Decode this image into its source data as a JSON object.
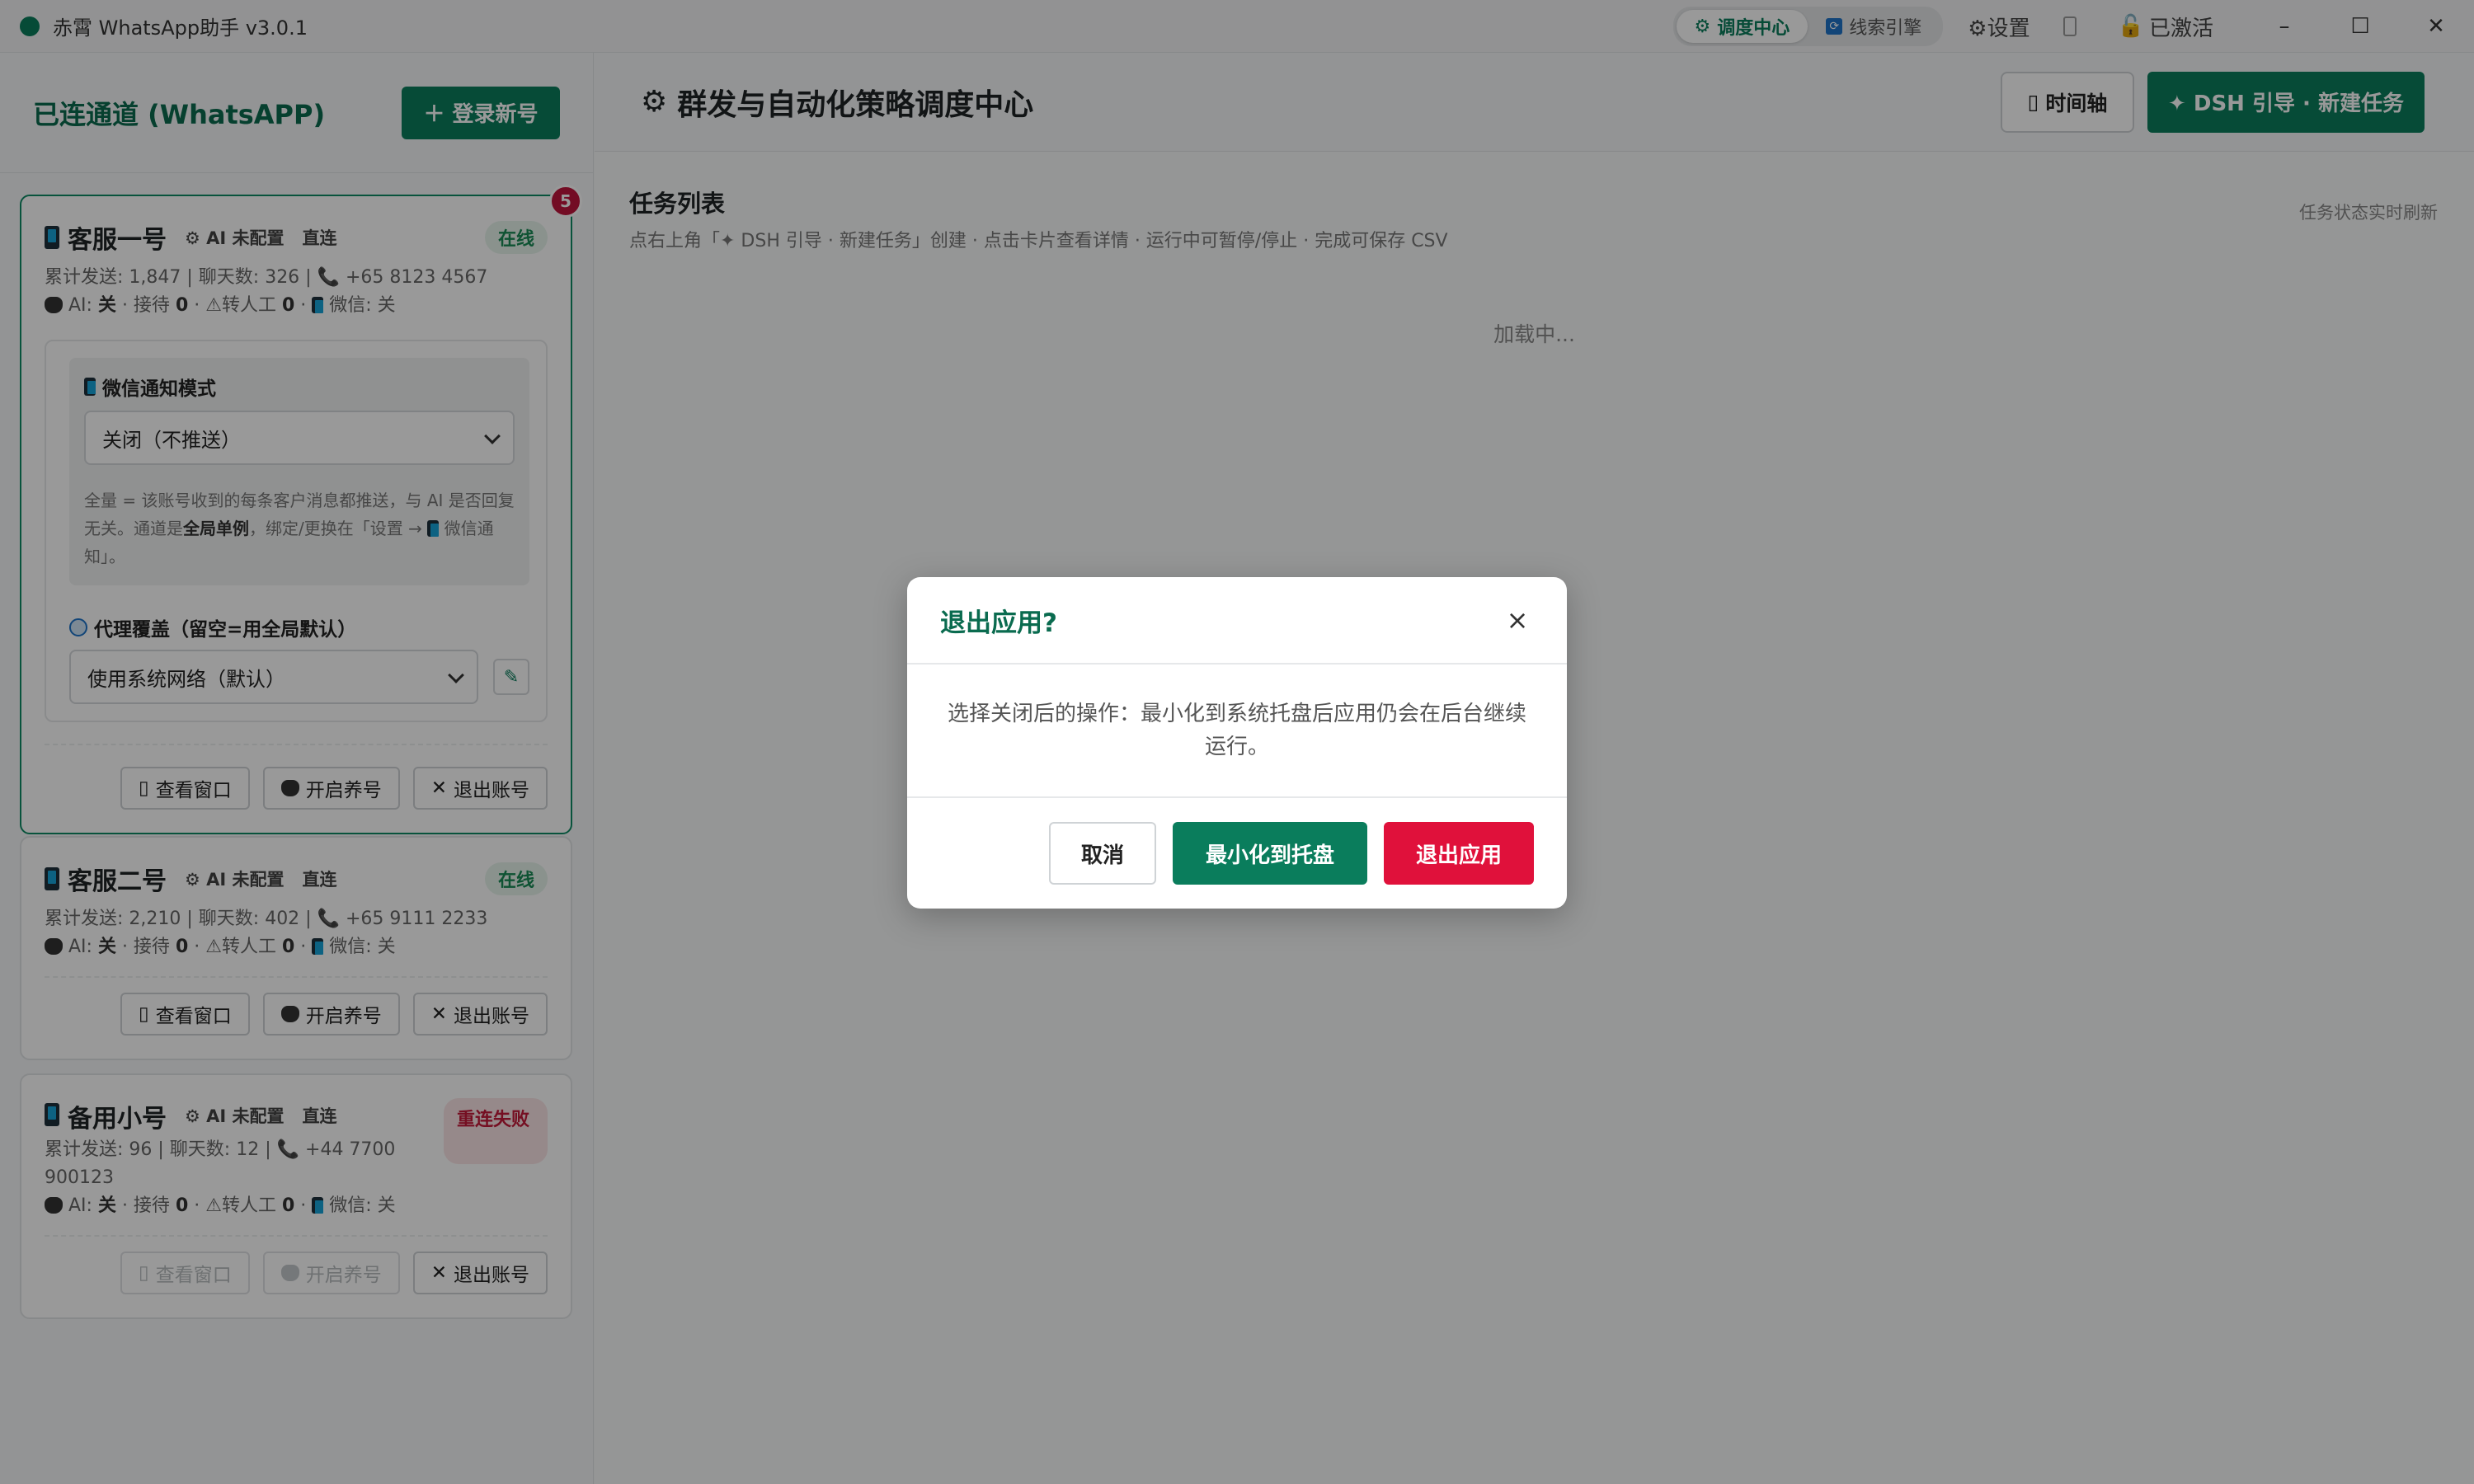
{
  "window": {
    "title": "赤霄 WhatsApp助手 v3.0.1",
    "nav": [
      {
        "label": "调度中心",
        "icon": "gear-icon",
        "active": true
      },
      {
        "label": "线索引擎",
        "icon": "sync-icon",
        "active": false
      }
    ],
    "settings_label": "⚙设置",
    "activated_label": "已激活",
    "controls": {
      "minimize": "–",
      "maximize": "☐",
      "close": "✕"
    }
  },
  "sidebar": {
    "title": "已连通道 (WhatsAPP)",
    "login_button": "＋ 登录新号",
    "accounts": [
      {
        "name": "客服一号",
        "ai_tag": "⚙ AI 未配置",
        "direct_tag": "直连",
        "status": "在线",
        "badge": "5",
        "stats_line1_prefix": "累计发送: 1,847 | 聊天数: 326 | ",
        "phone": "+65 8123 4567",
        "ai_label": " AI: ",
        "ai_value": "关",
        "reception_label": " · 接待 ",
        "reception_value": "0",
        "transfer_label": " · ⚠转人工 ",
        "transfer_value": "0",
        "wechat_label": " 微信: ",
        "wechat_value": "关",
        "wx_mode_label": "微信通知模式",
        "wx_mode_value": "关闭（不推送）",
        "wx_note_1": "全量 = 该账号收到的每条客户消息都推送，与 AI 是否回复无关。通道是",
        "wx_note_bold": "全局单例",
        "wx_note_2": "，绑定/更换在「设置 → ",
        "wx_note_3": " 微信通知」。",
        "proxy_label": "代理覆盖（留空=用全局默认）",
        "proxy_value": "使用系统网络（默认）",
        "actions": {
          "view": "查看窗口",
          "nurture": "开启养号",
          "logout": "退出账号"
        }
      },
      {
        "name": "客服二号",
        "ai_tag": "⚙ AI 未配置",
        "direct_tag": "直连",
        "status": "在线",
        "stats_line1_prefix": "累计发送: 2,210 | 聊天数: 402 | ",
        "phone": "+65 9111 2233",
        "ai_label": " AI: ",
        "ai_value": "关",
        "reception_label": " · 接待 ",
        "reception_value": "0",
        "transfer_label": " · ⚠转人工 ",
        "transfer_value": "0",
        "wechat_label": " 微信: ",
        "wechat_value": "关",
        "actions": {
          "view": "查看窗口",
          "nurture": "开启养号",
          "logout": "退出账号"
        }
      },
      {
        "name": "备用小号",
        "ai_tag": "⚙ AI 未配置",
        "direct_tag": "直连",
        "status": "重连失败",
        "stats_line1_prefix": "累计发送: 96 | 聊天数: 12 | ",
        "phone": "+44 7700 900123",
        "ai_label": " AI: ",
        "ai_value": "关",
        "reception_label": " · 接待 ",
        "reception_value": "0",
        "transfer_label": " · ⚠转人工 ",
        "transfer_value": "0",
        "wechat_label": " 微信: ",
        "wechat_value": "关",
        "actions": {
          "view": "查看窗口",
          "nurture": "开启养号",
          "logout": "退出账号"
        }
      }
    ]
  },
  "main": {
    "title": "群发与自动化策略调度中心",
    "timeline_button": "时间轴",
    "new_task_button": "✦ DSH 引导 · 新建任务",
    "task_list": {
      "title": "任务列表",
      "subtitle": "点右上角「✦ DSH 引导 · 新建任务」创建 · 点击卡片查看详情 · 运行中可暂停/停止 · 完成可保存 CSV",
      "refresh_note": "任务状态实时刷新",
      "loading": "加载中..."
    }
  },
  "modal": {
    "title": "退出应用?",
    "close": "×",
    "body": "选择关闭后的操作：最小化到系统托盘后应用仍会在后台继续运行。",
    "cancel": "取消",
    "minimize_tray": "最小化到托盘",
    "quit": "退出应用"
  },
  "colors": {
    "brand": "#0a7d5c",
    "danger": "#e0113b",
    "online_bg": "#e6f4ec",
    "fail_bg": "#fbe4e6"
  }
}
